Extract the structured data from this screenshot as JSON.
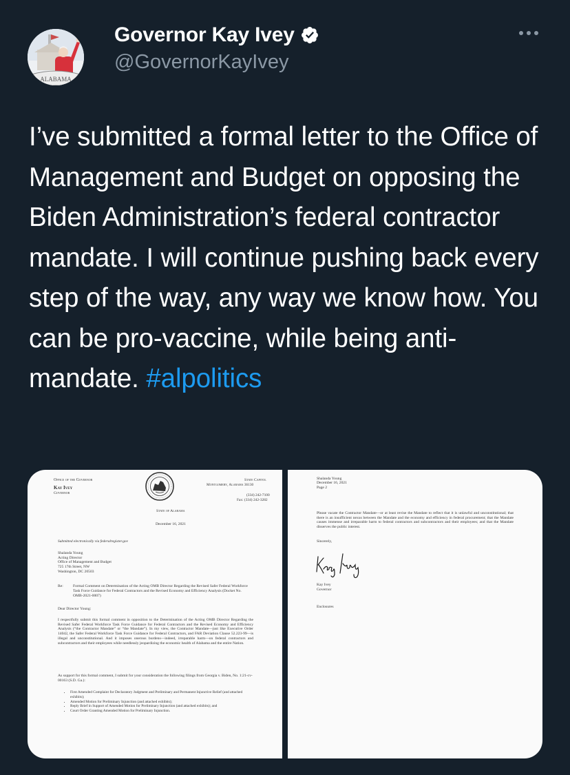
{
  "author": {
    "name": "Governor Kay Ivey",
    "handle": "@GovernorKayIvey",
    "avatar_text": "ALABAMA"
  },
  "tweet": {
    "text": "I’ve submitted a formal letter to the Office of Management and Budget on opposing the Biden Administration’s federal contractor mandate. I will continue pushing back every step of the way, any way we know how. You can be pro-vaccine, while being anti-mandate. ",
    "hashtag": "#alpolitics"
  },
  "letter_page1": {
    "office": "Office of the Governor",
    "governor_name": "Kay Ivey",
    "governor_title": "Governor",
    "capitol": "State Capitol",
    "city": "Montgomery, Alabama 36130",
    "phone": "(334) 242-7100",
    "fax": "Fax: (334) 242-3282",
    "state": "State of Alabama",
    "date": "December 16, 2021",
    "submitted": "Submitted electronically via federalregister.gov",
    "address": "Shalanda Young\nActing Director\nOffice of Management and Budget\n725 17th Street, NW\nWashington, DC 20503",
    "re_label": "Re:",
    "re_text": "Formal Comment on Determination of the Acting OMB Director Regarding the Revised Safer Federal Workforce Task Force Guidance for Federal Contractors and the Revised Economy and Efficiency Analysis (Docket No. OMB-2021-0007)",
    "salutation": "Dear Director Young:",
    "body1": "I respectfully submit this formal comment in opposition to the Determination of the Acting OMB Director Regarding the Revised Safer Federal Workforce Task Force Guidance for Federal Contractors and the Revised Economy and Efficiency Analysis (“the Contractor Mandate” or “the Mandate”). In my view, the Contractor Mandate—just like Executive Order 14042, the Safer Federal Workforce Task Force Guidance for Federal Contractors, and FAR Deviation Clause 52.223-99—is illegal and unconstitutional. And it imposes onerous burdens—indeed, irreparable harm—on federal contractors and subcontractors and their employees while needlessly jeopardizing the economic health of Alabama and the entire Nation.",
    "body2": "As support for this formal comment, I submit for your consideration the following filings from Georgia v. Biden, No. 1:21-cv-00163 (S.D. Ga.):",
    "bullets": [
      "First Amended Complaint for Declaratory Judgment and Preliminary and Permanent Injunctive Relief (and attached exhibits);",
      "Amended Motion for Preliminary Injunction (and attached exhibits);",
      "Reply Brief in Support of Amended Motion for Preliminary Injunction (and attached exhibits); and",
      "Court Order Granting Amended Motion for Preliminary Injunction."
    ]
  },
  "letter_page2": {
    "header": "Shalanda Young\nDecember 16, 2021\nPage 2",
    "body": "Please vacate the Contractor Mandate—or at least revise the Mandate to reflect that it is unlawful and unconstitutional; that there is an insufficient nexus between the Mandate and the economy and efficiency in federal procurement; that the Mandate causes immense and irreparable harm to federal contractors and subcontractors and their employees; and that the Mandate disserves the public interest.",
    "closing": "Sincerely,",
    "signature": "Kay Ivey",
    "signer_name": "Kay Ivey",
    "signer_title": "Governor",
    "enclosures": "Enclosures"
  },
  "icons": [
    "verified-badge-icon",
    "more-options-icon",
    "state-seal-icon",
    "signature-icon"
  ],
  "colors": {
    "background": "#15202b",
    "text": "#ffffff",
    "secondary_text": "#8b98a5",
    "link": "#1d9bf0",
    "verified": "#ffffff"
  }
}
